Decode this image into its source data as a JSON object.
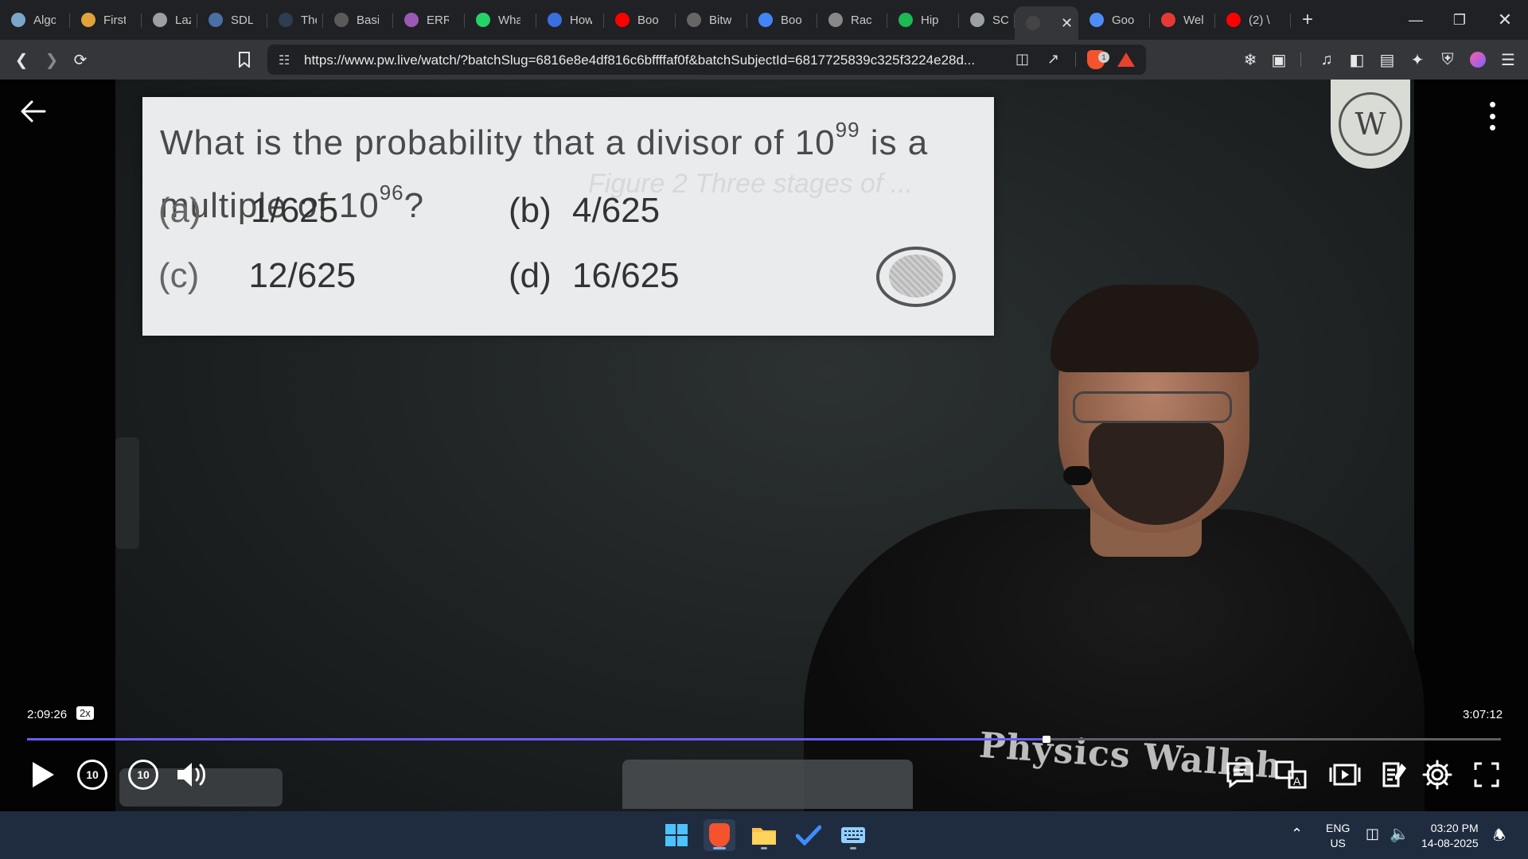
{
  "tabs": [
    {
      "title": "Algo",
      "favicon": "algo-circle-icon",
      "color": "#7aa7c7"
    },
    {
      "title": "First",
      "favicon": "lightning-icon",
      "color": "#e2a23a"
    },
    {
      "title": "Lazy",
      "favicon": "globe-icon",
      "color": "#9aa0a6"
    },
    {
      "title": "SDL",
      "favicon": "sdl-icon",
      "color": "#4a6fa5"
    },
    {
      "title": "The",
      "favicon": "w3-icon",
      "color": "#2c3e50"
    },
    {
      "title": "Basi",
      "favicon": "doc-icon",
      "color": "#5a5a5a"
    },
    {
      "title": "ERR",
      "favicon": "mushroom-icon",
      "color": "#9b59b6"
    },
    {
      "title": "Wha",
      "favicon": "whatsapp-icon",
      "color": "#25d366"
    },
    {
      "title": "How",
      "favicon": "bookmark-icon",
      "color": "#3b6fe0"
    },
    {
      "title": "Boo",
      "favicon": "youtube-icon",
      "color": "#ff0000"
    },
    {
      "title": "Bitw",
      "favicon": "bitwise-icon",
      "color": "#666"
    },
    {
      "title": "Boo",
      "favicon": "google-icon",
      "color": "#4285f4"
    },
    {
      "title": "Rac",
      "favicon": "openai-icon",
      "color": "#888"
    },
    {
      "title": "Hip",
      "favicon": "spotify-icon",
      "color": "#1db954"
    },
    {
      "title": "SCII",
      "favicon": "globe-icon",
      "color": "#9aa0a6"
    },
    {
      "title": "",
      "favicon": "pw-icon",
      "color": "#444",
      "active": true
    },
    {
      "title": "Goo",
      "favicon": "gemini-icon",
      "color": "#4e8df5"
    },
    {
      "title": "Wel",
      "favicon": "red-circle-icon",
      "color": "#e53935"
    },
    {
      "title": "(2) \\",
      "favicon": "youtube-icon",
      "color": "#ff0000"
    }
  ],
  "address": {
    "url": "https://www.pw.live/watch/?batchSlug=6816e8e4df816c6bffffaf0f&batchSubjectId=6817725839c325f3224e28d...",
    "brave_badge": "1"
  },
  "question": {
    "line1_pre": "What is the probability that a divisor of 10",
    "line1_exp": "99",
    "line1_post": " is a",
    "line2_pre": "multiple of 10",
    "line2_exp": "96",
    "line2_post": "?",
    "options": [
      {
        "label": "(a)",
        "value": "1/625"
      },
      {
        "label": "(b)",
        "value": "4/625"
      },
      {
        "label": "(c)",
        "value": "12/625"
      },
      {
        "label": "(d)",
        "value": "16/625"
      }
    ]
  },
  "logo": {
    "text": "W"
  },
  "player": {
    "current_time": "2:09:26",
    "speed": "2x",
    "total_time": "3:07:12",
    "progress_fraction": 0.6915,
    "rewind_seconds": "10",
    "forward_seconds": "10",
    "watermark": "Physics Wallah"
  },
  "tray": {
    "lang_top": "ENG",
    "lang_bottom": "US",
    "time": "03:20 PM",
    "date": "14-08-2025"
  }
}
